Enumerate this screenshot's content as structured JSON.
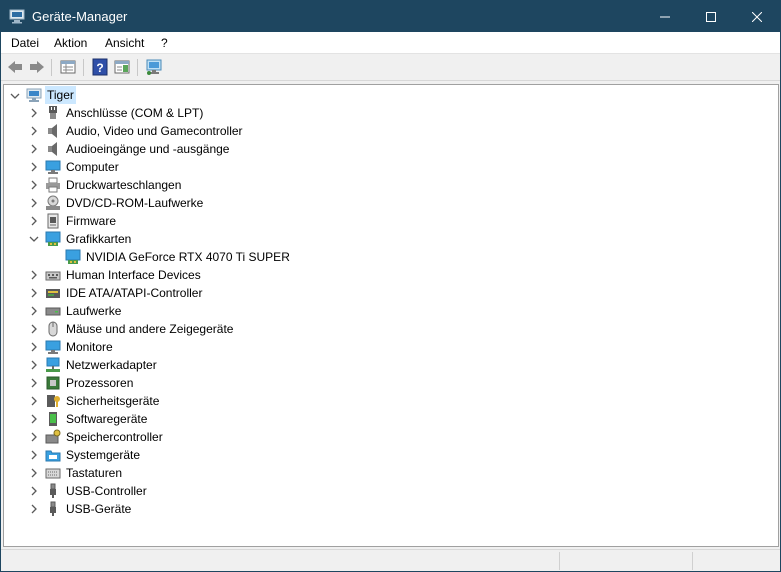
{
  "window": {
    "title": "Geräte-Manager",
    "titlebar_color": "#1e4660"
  },
  "menu": [
    "Datei",
    "Aktion",
    "Ansicht",
    "?"
  ],
  "toolbar": {
    "buttons": [
      "back-arrow-icon",
      "forward-arrow-icon",
      "properties-view-icon",
      "help-icon",
      "action-pane-icon",
      "scan-hardware-icon"
    ]
  },
  "tree": {
    "root": "Tiger",
    "categories": [
      {
        "label": "Anschlüsse (COM & LPT)",
        "icon": "port-icon",
        "expanded": false
      },
      {
        "label": "Audio, Video und Gamecontroller",
        "icon": "speaker-icon",
        "expanded": false
      },
      {
        "label": "Audioeingänge und -ausgänge",
        "icon": "speaker-icon",
        "expanded": false
      },
      {
        "label": "Computer",
        "icon": "monitor-icon",
        "expanded": false
      },
      {
        "label": "Druckwarteschlangen",
        "icon": "printer-icon",
        "expanded": false
      },
      {
        "label": "DVD/CD-ROM-Laufwerke",
        "icon": "disc-drive-icon",
        "expanded": false
      },
      {
        "label": "Firmware",
        "icon": "firmware-icon",
        "expanded": false
      },
      {
        "label": "Grafikkarten",
        "icon": "display-adapter-icon",
        "expanded": true,
        "children": [
          {
            "label": "NVIDIA GeForce RTX 4070 Ti SUPER",
            "icon": "display-adapter-icon"
          }
        ]
      },
      {
        "label": "Human Interface Devices",
        "icon": "hid-icon",
        "expanded": false
      },
      {
        "label": "IDE ATA/ATAPI-Controller",
        "icon": "ide-controller-icon",
        "expanded": false
      },
      {
        "label": "Laufwerke",
        "icon": "disk-drive-icon",
        "expanded": false
      },
      {
        "label": "Mäuse und andere Zeigegeräte",
        "icon": "mouse-icon",
        "expanded": false
      },
      {
        "label": "Monitore",
        "icon": "monitor-icon",
        "expanded": false
      },
      {
        "label": "Netzwerkadapter",
        "icon": "network-icon",
        "expanded": false
      },
      {
        "label": "Prozessoren",
        "icon": "cpu-icon",
        "expanded": false
      },
      {
        "label": "Sicherheitsgeräte",
        "icon": "security-key-icon",
        "expanded": false
      },
      {
        "label": "Softwaregeräte",
        "icon": "software-device-icon",
        "expanded": false
      },
      {
        "label": "Speichercontroller",
        "icon": "storage-controller-icon",
        "expanded": false
      },
      {
        "label": "Systemgeräte",
        "icon": "system-folder-icon",
        "expanded": false
      },
      {
        "label": "Tastaturen",
        "icon": "keyboard-icon",
        "expanded": false
      },
      {
        "label": "USB-Controller",
        "icon": "usb-icon",
        "expanded": false
      },
      {
        "label": "USB-Geräte",
        "icon": "usb-icon",
        "expanded": false
      }
    ]
  }
}
